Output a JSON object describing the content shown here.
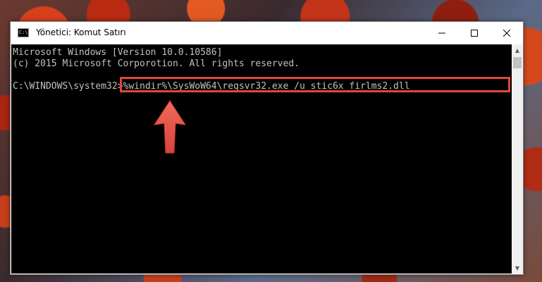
{
  "window": {
    "title": "Yönetici: Komut Satırı",
    "icon": "cmd-icon",
    "icon_text": "C:\\"
  },
  "console": {
    "lines": [
      "Microsoft Windows [Version 10.0.10586]",
      "(c) 2015 Microsoft Corporotion. All rights reserved.",
      "C:\\WINDOWS\\system32>%windir%\\SysWoW64\\regsvr32.exe /u stic6x_firlms2.dll"
    ]
  },
  "colors": {
    "console_bg": "#000000",
    "console_text": "#c0c0c0",
    "highlight": "#e0463a"
  }
}
